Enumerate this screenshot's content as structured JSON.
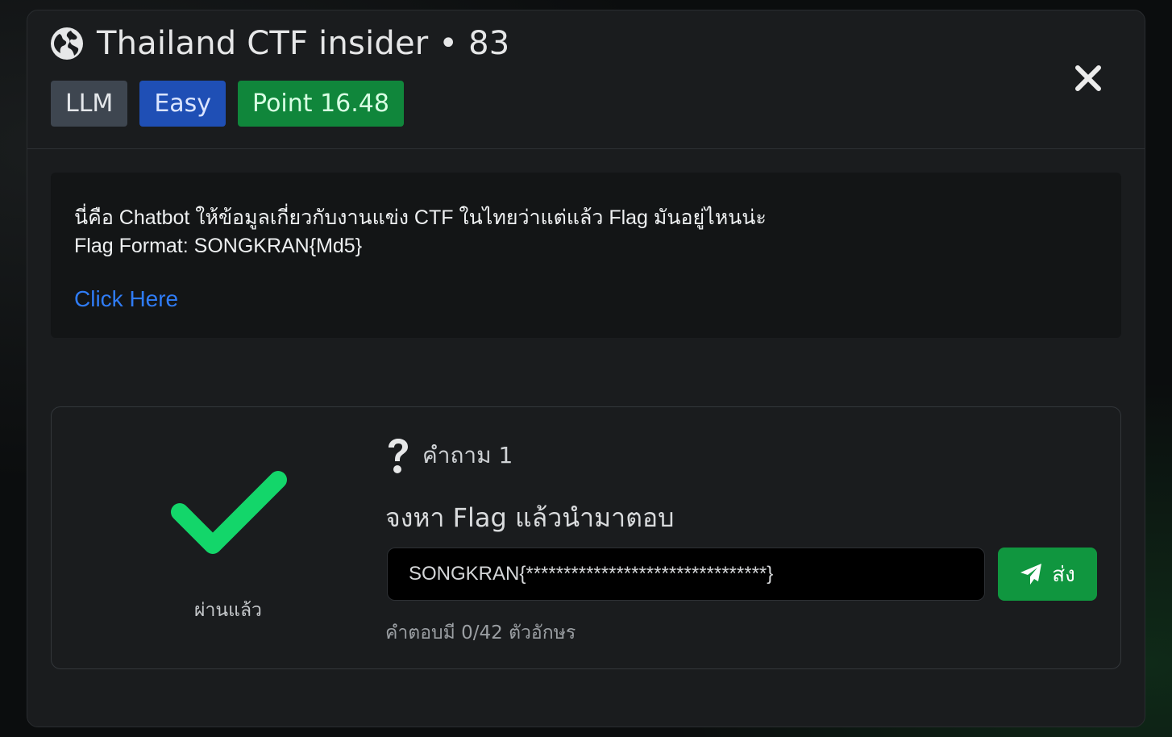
{
  "challenge": {
    "title": "Thailand CTF insider • 83",
    "icon": "globe-icon",
    "tags": {
      "category": "LLM",
      "difficulty": "Easy",
      "points": "Point 16.48"
    }
  },
  "description": {
    "line1": "นี่คือ Chatbot ให้ข้อมูลเกี่ยวกับงานแข่ง CTF ในไทยว่าแต่แล้ว Flag มันอยู่ไหนน่ะ",
    "line2": "Flag Format: SONGKRAN{Md5}",
    "link_text": "Click Here"
  },
  "question": {
    "status_label": "ผ่านแล้ว",
    "number_label": "คำถาม 1",
    "prompt": "จงหา Flag แล้วนำมาตอบ",
    "answer_value": "SONGKRAN{********************************}",
    "send_label": "ส่ง",
    "counter_text": "คำตอบมี 0/42 ตัวอักษร"
  },
  "colors": {
    "accent_green": "#10963f",
    "check_green": "#13d66a",
    "easy_blue": "#1f4fb5",
    "link_blue": "#2f7cf6",
    "llm_gray": "#3e4650"
  }
}
